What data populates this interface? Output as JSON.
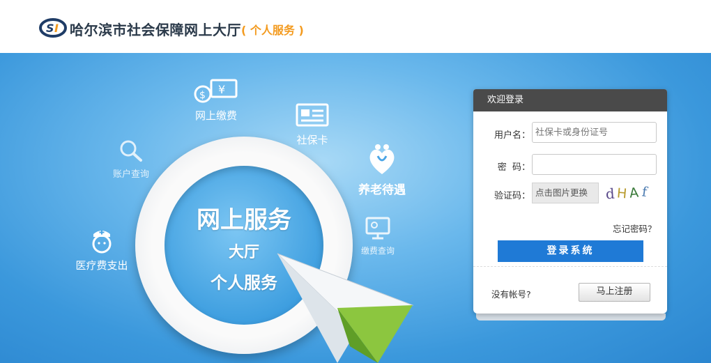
{
  "header": {
    "logo_text": "SI",
    "title": "哈尔滨市社会保障网上大厅",
    "subtitle": "( 个人服务 )"
  },
  "banner": {
    "features": [
      {
        "label": "网上缴费",
        "icon": "money-icon"
      },
      {
        "label": "社保卡",
        "icon": "card-icon"
      },
      {
        "label": "账户查询",
        "icon": "search-icon"
      },
      {
        "label": "养老待遇",
        "icon": "heart-people-icon"
      },
      {
        "label": "医疗费支出",
        "icon": "nurse-icon"
      },
      {
        "label": "缴费查询",
        "icon": "screen-icon"
      }
    ],
    "ring_title": "网上服务",
    "ring_line2": "大厅",
    "ring_line3": "个人服务"
  },
  "login": {
    "header": "欢迎登录",
    "username_label": "用户名：",
    "username_placeholder": "社保卡或身份证号",
    "password_label": "密  码：",
    "captcha_label": "验证码：",
    "captcha_placeholder": "点击图片更换",
    "captcha_text": "dHAf",
    "forgot": "忘记密码？",
    "login_button": "登录系统",
    "no_account": "没有帐号?",
    "register_button": "马上注册"
  }
}
